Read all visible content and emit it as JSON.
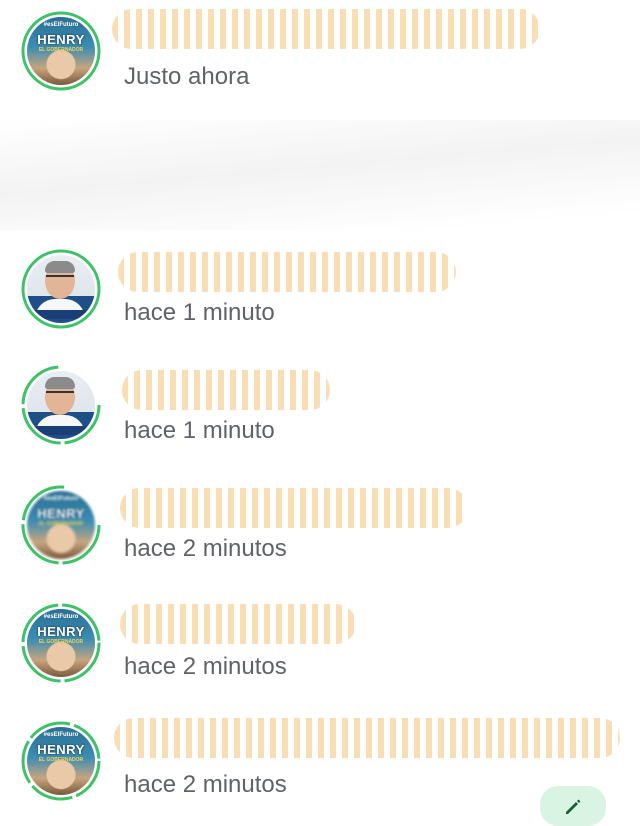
{
  "status_ring_color": "#3ec267",
  "items": [
    {
      "time": "Justo ahora",
      "avatar": "henry-poster",
      "poster_top": "#esElFuturo",
      "poster_title": "HENRY",
      "poster_sub": "EL GOBERNADOR"
    },
    {
      "time": "hace 1 minuto",
      "avatar": "man-portrait"
    },
    {
      "time": "hace 1 minuto",
      "avatar": "man-portrait-partial"
    },
    {
      "time": "hace 2 minutos",
      "avatar": "henry-poster",
      "poster_top": "#esElFuturo",
      "poster_title": "HENRY",
      "poster_sub": "EL GOBERNADOR"
    },
    {
      "time": "hace 2 minutos",
      "avatar": "henry-poster",
      "poster_top": "#esElFuturo",
      "poster_title": "HENRY",
      "poster_sub": "EL GOBERNADOR"
    },
    {
      "time": "hace 2 minutos",
      "avatar": "henry-poster",
      "poster_top": "#esElFuturo",
      "poster_title": "HENRY",
      "poster_sub": "EL GOBERNADOR"
    }
  ],
  "fab_icon": "edit-pencil-icon"
}
